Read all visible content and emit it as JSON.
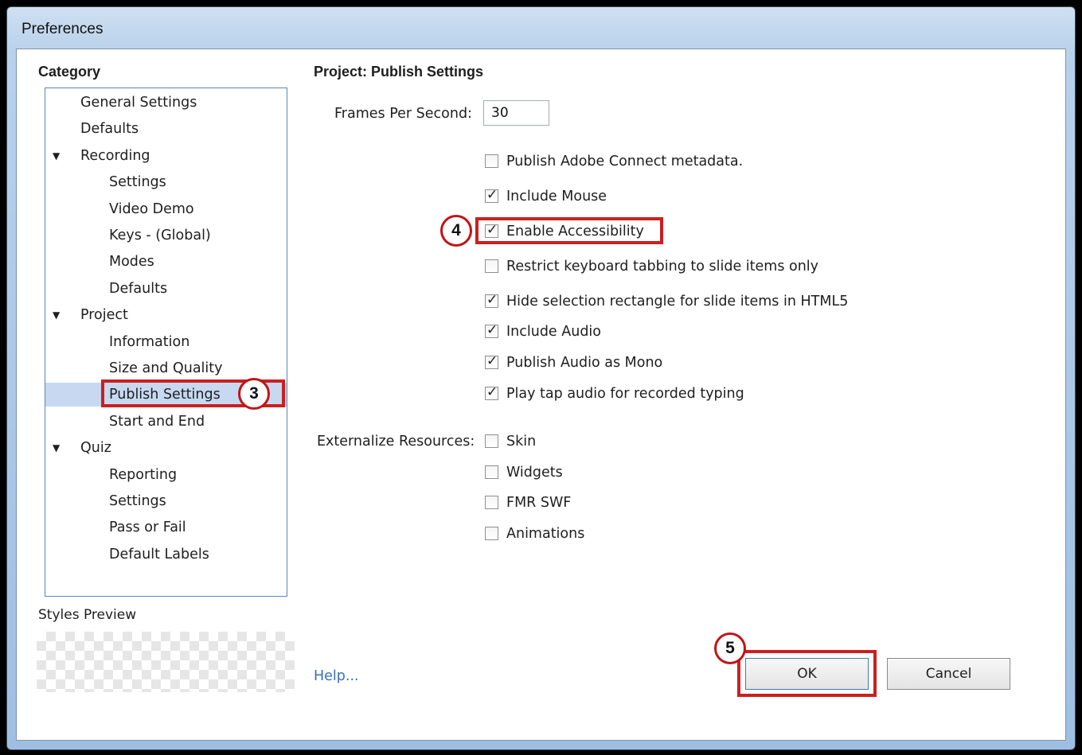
{
  "window": {
    "title": "Preferences"
  },
  "category": {
    "heading": "Category",
    "items": [
      {
        "label": "General Settings",
        "level": 0,
        "expandable": false
      },
      {
        "label": "Defaults",
        "level": 0,
        "expandable": false
      },
      {
        "label": "Recording",
        "level": 0,
        "expandable": true
      },
      {
        "label": "Settings",
        "level": 1,
        "expandable": false
      },
      {
        "label": "Video Demo",
        "level": 1,
        "expandable": false
      },
      {
        "label": "Keys - (Global)",
        "level": 1,
        "expandable": false
      },
      {
        "label": "Modes",
        "level": 1,
        "expandable": false
      },
      {
        "label": "Defaults",
        "level": 1,
        "expandable": false
      },
      {
        "label": "Project",
        "level": 0,
        "expandable": true
      },
      {
        "label": "Information",
        "level": 1,
        "expandable": false
      },
      {
        "label": "Size and Quality",
        "level": 1,
        "expandable": false
      },
      {
        "label": "Publish Settings",
        "level": 1,
        "expandable": false,
        "selected": true
      },
      {
        "label": "Start and End",
        "level": 1,
        "expandable": false
      },
      {
        "label": "Quiz",
        "level": 0,
        "expandable": true
      },
      {
        "label": "Reporting",
        "level": 1,
        "expandable": false
      },
      {
        "label": "Settings",
        "level": 1,
        "expandable": false
      },
      {
        "label": "Pass or Fail",
        "level": 1,
        "expandable": false
      },
      {
        "label": "Default Labels",
        "level": 1,
        "expandable": false
      }
    ],
    "expand_glyph": "▼"
  },
  "styles_preview": {
    "label": "Styles Preview"
  },
  "panel": {
    "heading": "Project: Publish Settings",
    "fps": {
      "label": "Frames Per Second:",
      "value": "30"
    },
    "options": [
      {
        "label": "Publish Adobe Connect metadata.",
        "checked": false
      },
      {
        "label": "Include Mouse",
        "checked": true
      },
      {
        "label": "Enable Accessibility",
        "checked": true
      },
      {
        "label": "Restrict keyboard tabbing to slide items only",
        "checked": false
      },
      {
        "label": "Hide selection rectangle for slide items in HTML5",
        "checked": true
      },
      {
        "label": "Include Audio",
        "checked": true
      },
      {
        "label": "Publish Audio as Mono",
        "checked": true
      },
      {
        "label": "Play tap audio for recorded typing",
        "checked": true
      }
    ],
    "externalize": {
      "label": "Externalize Resources:",
      "options": [
        {
          "label": "Skin",
          "checked": false
        },
        {
          "label": "Widgets",
          "checked": false
        },
        {
          "label": "FMR SWF",
          "checked": false
        },
        {
          "label": "Animations",
          "checked": false
        }
      ]
    },
    "check_glyph": "✓"
  },
  "footer": {
    "help": "Help...",
    "ok": "OK",
    "cancel": "Cancel"
  },
  "annotations": {
    "step3": "3",
    "step4": "4",
    "step5": "5",
    "highlight_color": "#cc1f1f"
  }
}
